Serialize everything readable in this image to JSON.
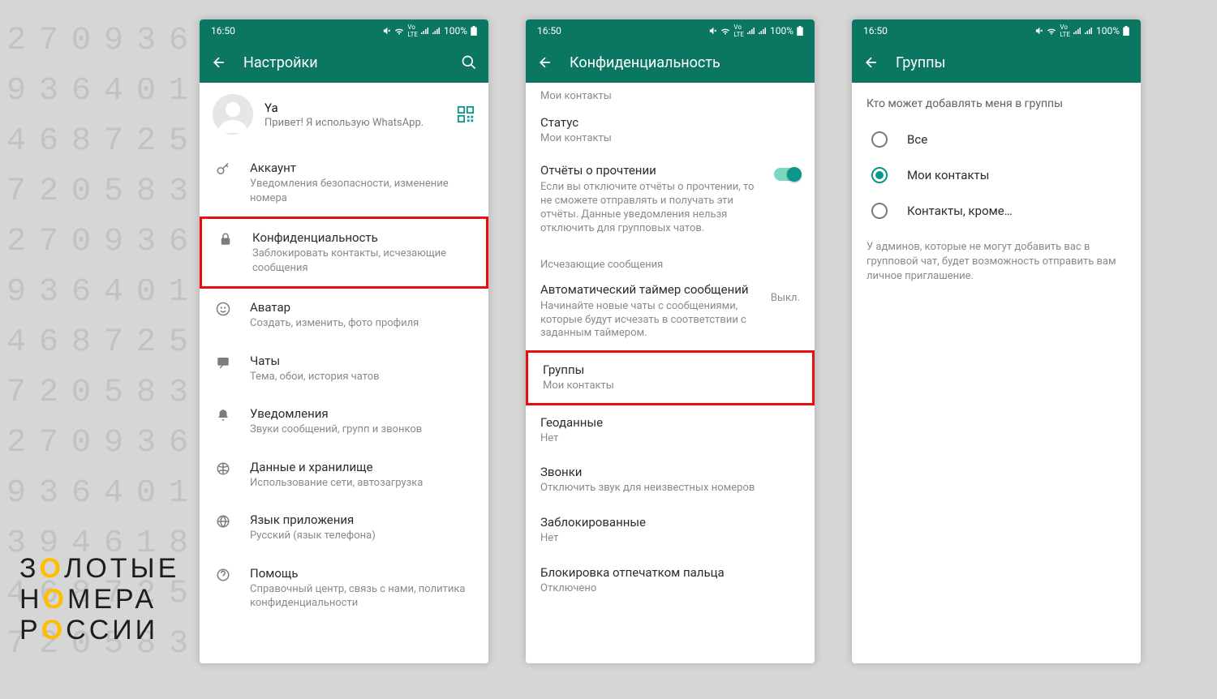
{
  "status": {
    "time": "16:50",
    "battery": "100%"
  },
  "bg_lines": "2709364687\n936401530\n4687253\n720583\n2709364\n9364015\n4687253\n720583\n2709364\n9364015\n394618\n468725\n7205839",
  "logo": {
    "l1_pre": "З",
    "l1_y": "О",
    "l1_post": "ЛОТЫЕ",
    "l2_pre": "Н",
    "l2_y": "О",
    "l2_post": "МЕРА",
    "l3_pre": "Р",
    "l3_y": "О",
    "l3_post": "ССИИ"
  },
  "s1": {
    "title": "Настройки",
    "profile": {
      "name": "Ya",
      "subtitle": "Привет! Я использую WhatsApp."
    },
    "rows": {
      "account": {
        "title": "Аккаунт",
        "sub": "Уведомления безопасности, изменение номера"
      },
      "privacy": {
        "title": "Конфиденциальность",
        "sub": "Заблокировать контакты, исчезающие сообщения"
      },
      "avatar": {
        "title": "Аватар",
        "sub": "Создать, изменить, фото профиля"
      },
      "chats": {
        "title": "Чаты",
        "sub": "Тема, обои, история чатов"
      },
      "notifications": {
        "title": "Уведомления",
        "sub": "Звуки сообщений, групп и звонков"
      },
      "storage": {
        "title": "Данные и хранилище",
        "sub": "Использование сети, автозагрузка"
      },
      "language": {
        "title": "Язык приложения",
        "sub": "Русский (язык телефона)"
      },
      "help": {
        "title": "Помощь",
        "sub": "Справочный центр, связь с нами, политика конфиденциальности"
      }
    }
  },
  "s2": {
    "title": "Конфиденциальность",
    "my_contacts": "Мои контакты",
    "status": {
      "title": "Статус",
      "sub": "Мои контакты"
    },
    "read": {
      "title": "Отчёты о прочтении",
      "desc": "Если вы отключите отчёты о прочтении, то не сможете отправлять и получать эти отчёты. Данные уведомления нельзя отключить для групповых чатов."
    },
    "section": "Исчезающие сообщения",
    "timer": {
      "title": "Автоматический таймер сообщений",
      "desc": "Начинайте новые чаты с сообщениями, которые будут исчезать в соответствии с заданным таймером.",
      "value": "Выкл."
    },
    "groups": {
      "title": "Группы",
      "sub": "Мои контакты"
    },
    "geo": {
      "title": "Геоданные",
      "sub": "Нет"
    },
    "calls": {
      "title": "Звонки",
      "sub": "Отключить звук для неизвестных номеров"
    },
    "blocked": {
      "title": "Заблокированные",
      "sub": "Нет"
    },
    "finger": {
      "title": "Блокировка отпечатком пальца",
      "sub": "Отключено"
    }
  },
  "s3": {
    "title": "Группы",
    "heading": "Кто может добавлять меня в группы",
    "opts": {
      "all": "Все",
      "contacts": "Мои контакты",
      "except": "Контакты, кроме…"
    },
    "info": "У админов, которые не могут добавить вас в групповой чат, будет возможность отправить вам личное приглашение."
  }
}
